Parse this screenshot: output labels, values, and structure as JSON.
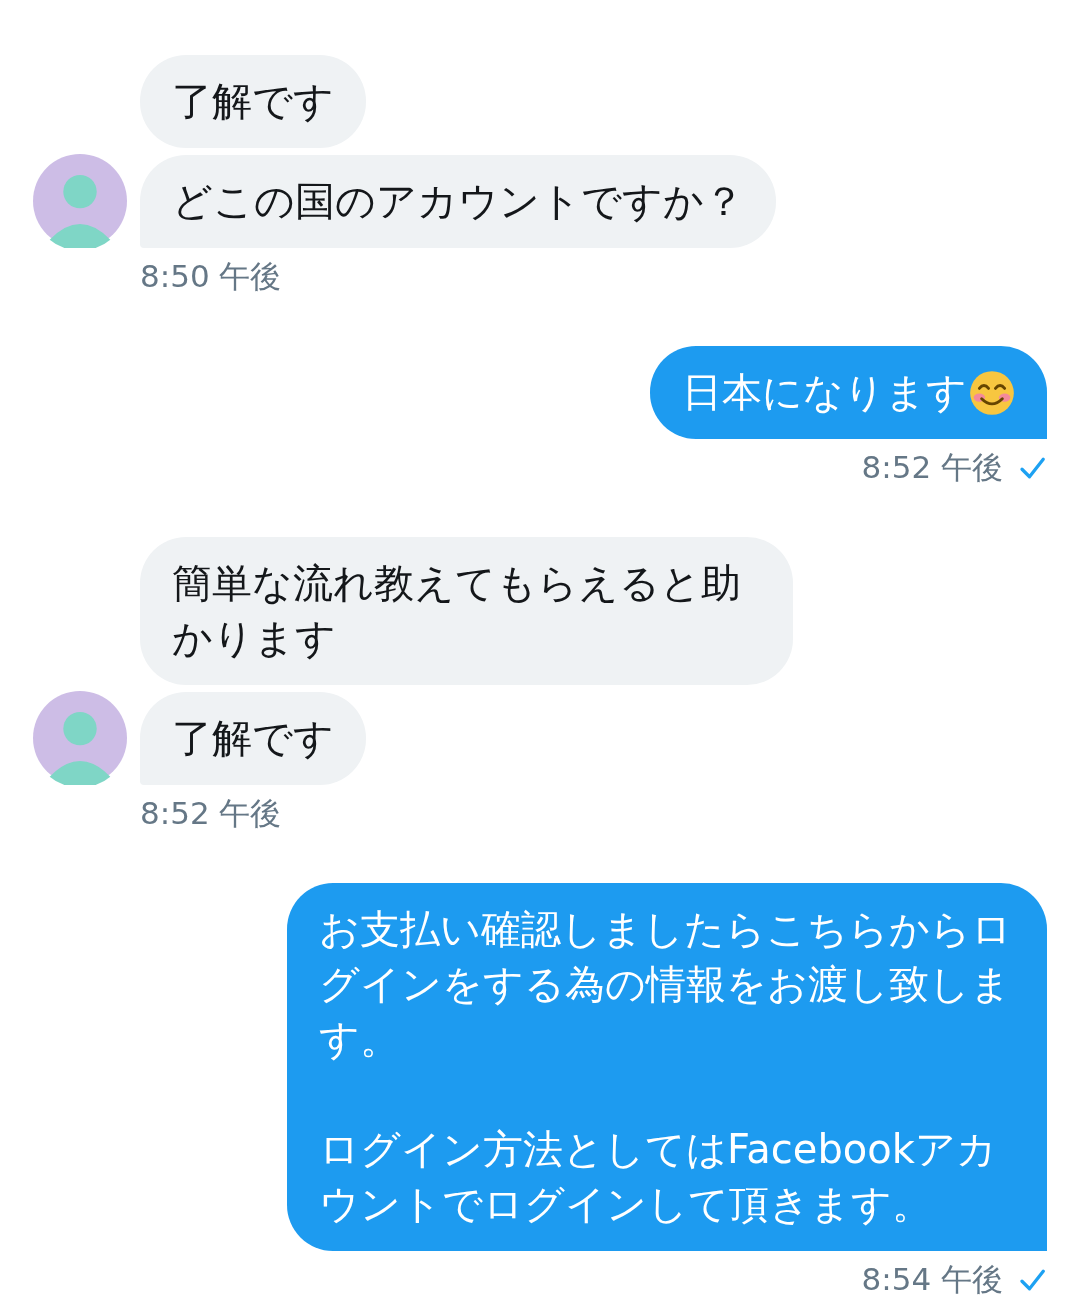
{
  "messages": [
    {
      "kind": "received",
      "bubbles": [
        {
          "paragraphs": [
            "了解です"
          ]
        },
        {
          "paragraphs": [
            "どこの国のアカウントですか？"
          ]
        }
      ],
      "time": "8:50 午後"
    },
    {
      "kind": "sent",
      "bubbles": [
        {
          "paragraphs": [
            "日本になります"
          ],
          "emoji": true
        }
      ],
      "time": "8:52 午後",
      "read": true
    },
    {
      "kind": "received",
      "bubbles": [
        {
          "paragraphs": [
            "簡単な流れ教えてもらえると助かります"
          ]
        },
        {
          "paragraphs": [
            "了解です"
          ]
        }
      ],
      "time": "8:52 午後"
    },
    {
      "kind": "sent",
      "bubbles": [
        {
          "paragraphs": [
            "お支払い確認しましたらこちらからログインをする為の情報をお渡し致します。",
            "ログイン方法としてはFacebookアカウントでログインして頂きます。"
          ]
        }
      ],
      "time": "8:54 午後",
      "read": true
    }
  ]
}
